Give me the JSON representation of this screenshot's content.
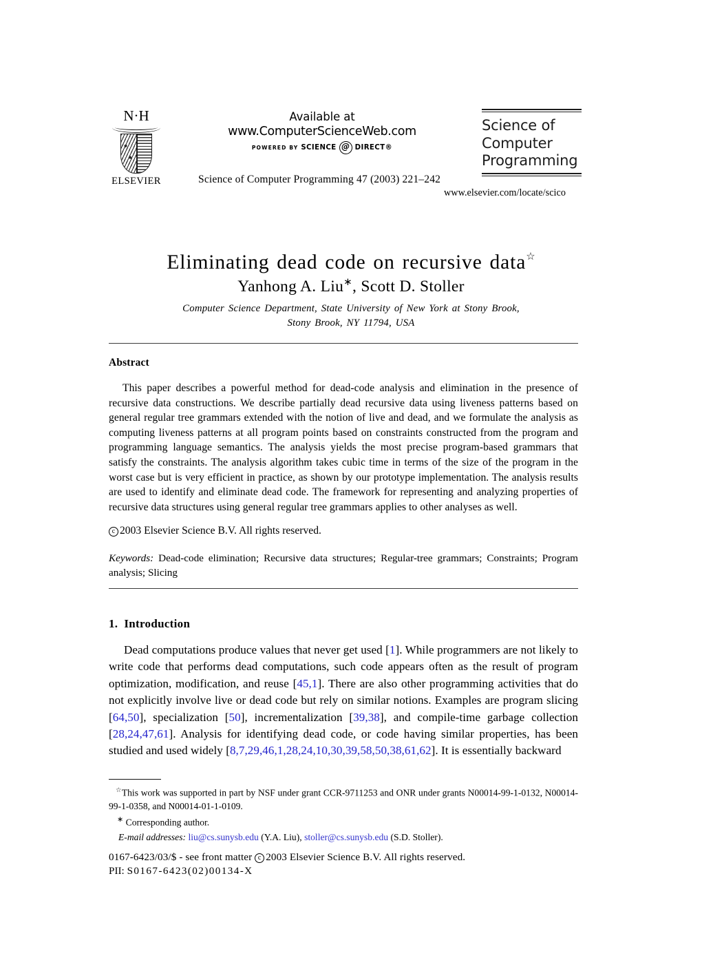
{
  "header": {
    "publisher_mark": "N·H",
    "publisher_name": "ELSEVIER",
    "available_at": "Available at",
    "available_url": "www.ComputerScienceWeb.com",
    "powered_by": "POWERED BY",
    "sd_science": "SCIENCE",
    "sd_at": "@",
    "sd_direct": "DIRECT®",
    "journal_logo_line1": "Science of",
    "journal_logo_line2": "Computer",
    "journal_logo_line3": "Programming",
    "journal_citation": "Science of Computer Programming 47 (2003) 221–242",
    "journal_url": "www.elsevier.com/locate/scico"
  },
  "article": {
    "title": "Eliminating dead code on recursive data",
    "title_footnote_marker": "☆",
    "authors": "Yanhong A. Liu",
    "author_marker": "∗",
    "authors_rest": ", Scott D. Stoller",
    "affiliation_line1": "Computer Science Department, State University of New York at Stony Brook,",
    "affiliation_line2": "Stony Brook, NY 11794, USA"
  },
  "abstract": {
    "heading": "Abstract",
    "body": "This paper describes a powerful method for dead-code analysis and elimination in the presence of recursive data constructions. We describe partially dead recursive data using liveness patterns based on general regular tree grammars extended with the notion of live and dead, and we formulate the analysis as computing liveness patterns at all program points based on constraints constructed from the program and programming language semantics. The analysis yields the most precise program-based grammars that satisfy the constraints. The analysis algorithm takes cubic time in terms of the size of the program in the worst case but is very efficient in practice, as shown by our prototype implementation. The analysis results are used to identify and eliminate dead code. The framework for representing and analyzing properties of recursive data structures using general regular tree grammars applies to other analyses as well.",
    "copyright_symbol": "c",
    "copyright_line": "2003 Elsevier Science B.V. All rights reserved.",
    "keywords_label": "Keywords:",
    "keywords_value": " Dead-code elimination; Recursive data structures; Regular-tree grammars; Constraints; Program analysis; Slicing"
  },
  "section1": {
    "number": "1.",
    "heading": "Introduction",
    "paragraph_parts": [
      {
        "text": "Dead computations produce values that never get used ["
      },
      {
        "cite": "1"
      },
      {
        "text": "]. While programmers are not likely to write code that performs dead computations, such code appears often as the result of program optimization, modification, and reuse ["
      },
      {
        "cite": "45,1"
      },
      {
        "text": "]. There are also other programming activities that do not explicitly involve live or dead code but rely on similar notions. Examples are program slicing ["
      },
      {
        "cite": "64,50"
      },
      {
        "text": "], specialization ["
      },
      {
        "cite": "50"
      },
      {
        "text": "], incrementalization ["
      },
      {
        "cite": "39,38"
      },
      {
        "text": "], and compile-time garbage collection ["
      },
      {
        "cite": "28,24,47,61"
      },
      {
        "text": "]. Analysis for identifying dead code, or code having similar properties, has been studied and used widely ["
      },
      {
        "cite": "8,7,29,46,1,28,24,10,30,39,58,50,38,61,62"
      },
      {
        "text": "]. It is essentially backward"
      }
    ]
  },
  "footnotes": {
    "support_marker": "☆",
    "support_text": "This work was supported in part by NSF under grant CCR-9711253 and ONR under grants N00014-99-1-0132, N00014-99-1-0358, and N00014-01-1-0109.",
    "corresponding_marker": "∗",
    "corresponding_text": "Corresponding author.",
    "email_label": "E-mail addresses:",
    "email1": "liu@cs.sunysb.edu",
    "email1_owner": "(Y.A. Liu),",
    "email2": "stoller@cs.sunysb.edu",
    "email2_owner": "(S.D. Stoller)."
  },
  "footer": {
    "front_matter": "0167-6423/03/$ - see front matter",
    "copyright_symbol": "c",
    "copyright_rest": "2003 Elsevier Science B.V. All rights reserved.",
    "pii_label": "PII:",
    "pii_code": "S0167-6423(02)00134-X"
  },
  "colors": {
    "link": "#2222cc",
    "rule": "#3a3a3a",
    "text": "#000000"
  }
}
